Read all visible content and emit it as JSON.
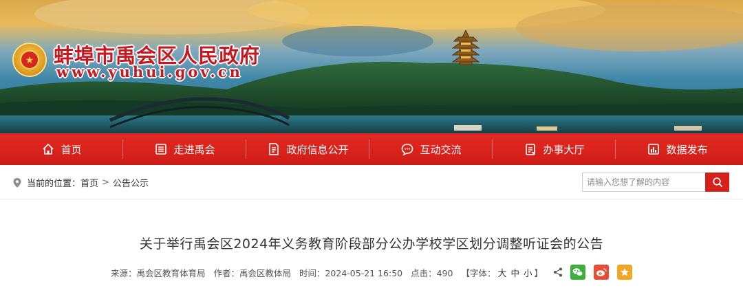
{
  "header": {
    "site_title": "蚌埠市禹会区人民政府",
    "site_url": "www.yuhui.gov.cn"
  },
  "nav": {
    "items": [
      {
        "label": "首页",
        "icon": "home-icon"
      },
      {
        "label": "走进禹会",
        "icon": "list-icon"
      },
      {
        "label": "政府信息公开",
        "icon": "document-icon"
      },
      {
        "label": "互动交流",
        "icon": "chat-icon"
      },
      {
        "label": "办事大厅",
        "icon": "clipboard-icon"
      },
      {
        "label": "数据发布",
        "icon": "chart-icon"
      }
    ]
  },
  "breadcrumb": {
    "prefix": "当前的位置：",
    "home": "首页",
    "separator": ">",
    "current": "公告公示"
  },
  "search": {
    "placeholder": "请输入您想了解的内容",
    "value": ""
  },
  "article": {
    "title": "关于举行禹会区2024年义务教育阶段部分公办学校学区划分调整听证会的公告",
    "source": "来源：禹会区教育体育局",
    "author": "作者：禹会区教体局",
    "time": "时间：2024-05-21 16:50",
    "clicks": "点击：490",
    "font_label": "【字体：",
    "font_large": "大",
    "font_medium": "中",
    "font_small": "小",
    "font_close": "】"
  },
  "colors": {
    "nav_red": "#d6201b",
    "title_red": "#c8171e",
    "wechat_green": "#3bb13b",
    "weibo_red": "#e94b35",
    "favorite_orange": "#f3a623"
  }
}
